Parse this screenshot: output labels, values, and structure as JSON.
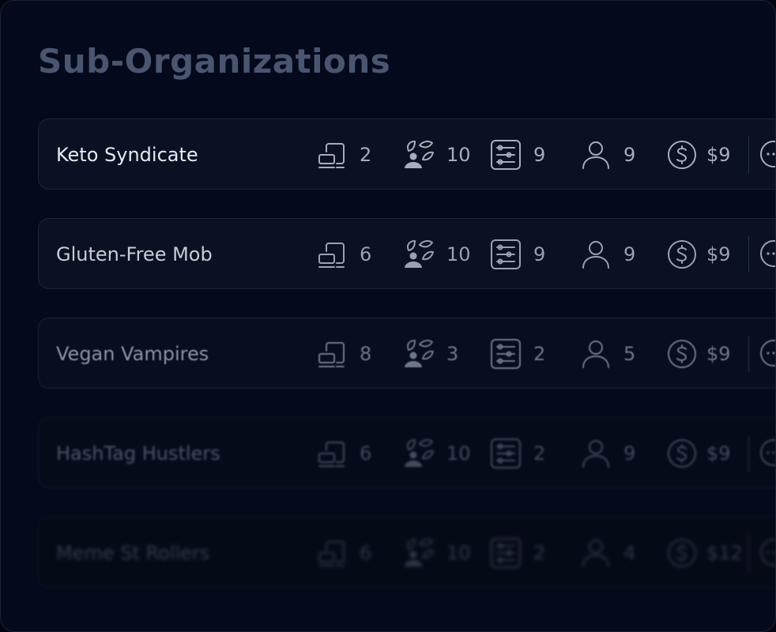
{
  "page": {
    "title": "Sub-Organizations"
  },
  "icons": {
    "devices": "devices-icon",
    "members": "people-icon",
    "settings": "sliders-icon",
    "users": "user-icon",
    "money": "dollar-icon",
    "more": "more-icon"
  },
  "rows": [
    {
      "name": "Keto Syndicate",
      "devices": "2",
      "members": "10",
      "settings": "9",
      "users": "9",
      "money": "$9"
    },
    {
      "name": "Gluten-Free Mob",
      "devices": "6",
      "members": "10",
      "settings": "9",
      "users": "9",
      "money": "$9"
    },
    {
      "name": "Vegan Vampires",
      "devices": "8",
      "members": "3",
      "settings": "2",
      "users": "5",
      "money": "$9"
    },
    {
      "name": "HashTag Hustlers",
      "devices": "6",
      "members": "10",
      "settings": "2",
      "users": "9",
      "money": "$9"
    },
    {
      "name": "Meme St Rollers",
      "devices": "6",
      "members": "10",
      "settings": "2",
      "users": "4",
      "money": "$12"
    }
  ],
  "colors": {
    "background": "#020510",
    "panel": "#040a1b",
    "title": "#4a5570",
    "row_border": "#1c2538"
  }
}
